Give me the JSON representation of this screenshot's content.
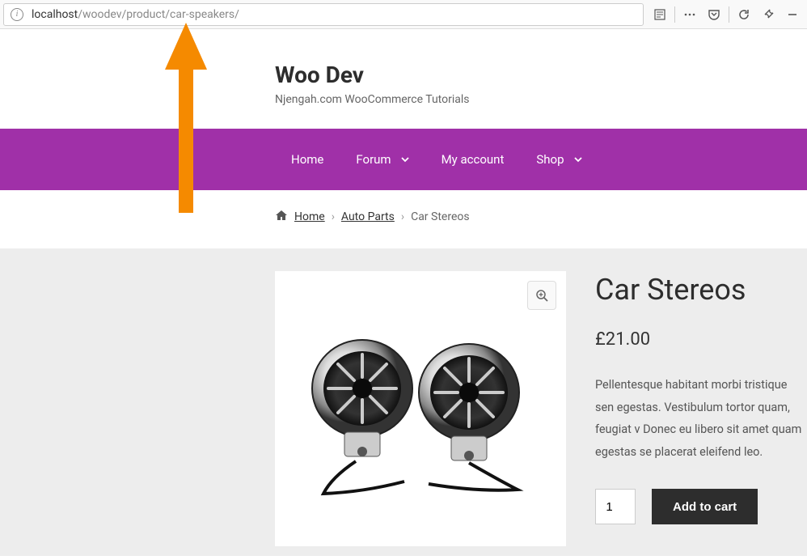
{
  "browser": {
    "url_host": "localhost",
    "url_path": "/woodev/product/car-speakers/"
  },
  "header": {
    "title": "Woo Dev",
    "tagline": "Njengah.com WooCommerce Tutorials"
  },
  "nav": {
    "items": [
      {
        "label": "Home",
        "dropdown": false
      },
      {
        "label": "Forum",
        "dropdown": true
      },
      {
        "label": "My account",
        "dropdown": false
      },
      {
        "label": "Shop",
        "dropdown": true
      }
    ]
  },
  "breadcrumb": {
    "home": "Home",
    "category": "Auto Parts",
    "current": "Car Stereos"
  },
  "product": {
    "title": "Car Stereos",
    "price": "£21.00",
    "description": "Pellentesque habitant morbi tristique sen egestas. Vestibulum tortor quam, feugiat v Donec eu libero sit amet quam egestas se placerat eleifend leo.",
    "quantity": "1",
    "add_to_cart": "Add to cart"
  }
}
